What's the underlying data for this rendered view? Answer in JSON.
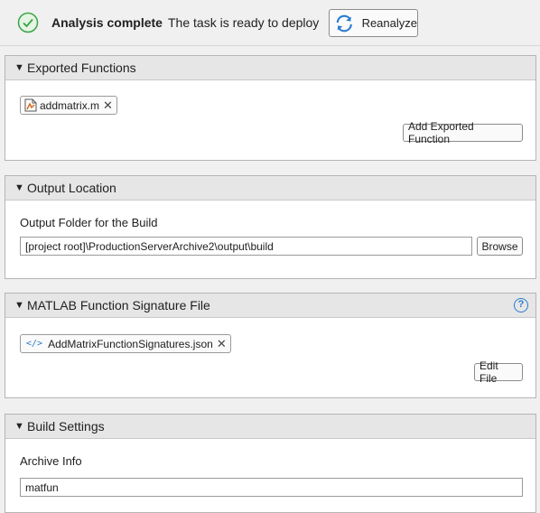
{
  "status": {
    "title": "Analysis complete",
    "message": "The task is ready to deploy",
    "reanalyze_label": "Reanalyze",
    "success_color": "#3aa346"
  },
  "exported_functions": {
    "header": "Exported Functions",
    "files": [
      {
        "name": "addmatrix.m",
        "icon": "matlab-file-icon"
      }
    ],
    "add_button": "Add Exported Function"
  },
  "output_location": {
    "header": "Output Location",
    "folder_label": "Output Folder for the Build",
    "folder_value": "[project root]\\ProductionServerArchive2\\output\\build",
    "browse_button": "Browse"
  },
  "signature_file": {
    "header": "MATLAB Function Signature File",
    "help": "?",
    "files": [
      {
        "name": "AddMatrixFunctionSignatures.json",
        "icon": "code-file-icon"
      }
    ],
    "edit_button": "Edit File"
  },
  "build_settings": {
    "header": "Build Settings",
    "archive_label": "Archive Info",
    "archive_value": "matfun"
  }
}
